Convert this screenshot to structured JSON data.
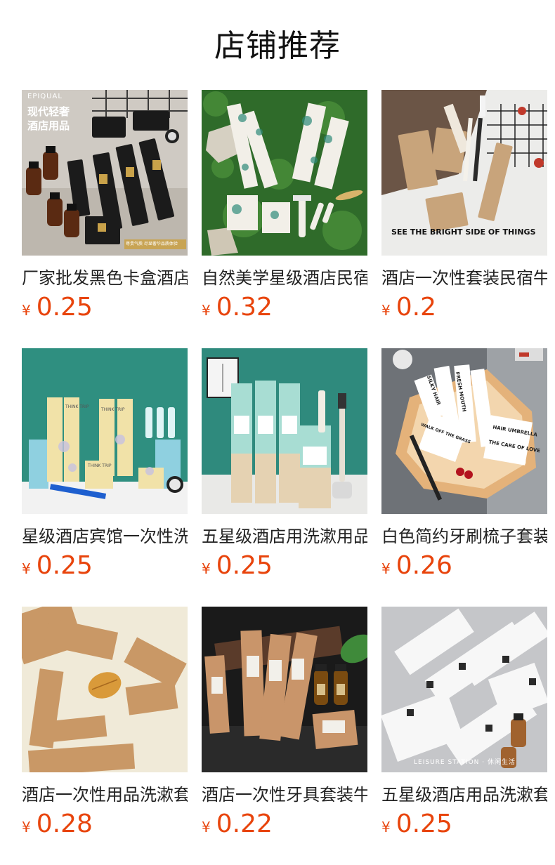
{
  "header": {
    "title": "店铺推荐"
  },
  "currency": "¥",
  "products": [
    {
      "name": "厂家批发黑色卡盒酒店用品套装",
      "price": "0.25",
      "image_text": [
        "EPIQUAL",
        "现代轻奢",
        "酒店用品",
        "尊贵气质 尽显奢华品质体验"
      ]
    },
    {
      "name": "自然美学星级酒店民宿一次性用品",
      "price": "0.32",
      "image_text": []
    },
    {
      "name": "酒店一次性套装民宿牛皮纸洗漱用品",
      "price": "0.2",
      "image_text": [
        "SEE THE BRIGHT SIDE OF THINGS"
      ]
    },
    {
      "name": "星级酒店宾馆一次性洗漱用品套装",
      "price": "0.25",
      "image_text": [
        "THINK TRIP",
        "THINK TRIP",
        "THINK TRIP"
      ]
    },
    {
      "name": "五星级酒店用洗漱用品牙具套装",
      "price": "0.25",
      "image_text": []
    },
    {
      "name": "白色简约牙刷梳子套装酒店用品",
      "price": "0.26",
      "image_text": [
        "HAIR UMBRELLA",
        "THE CARE OF LOVE",
        "FRESH MOUTH",
        "SILKY HAIR",
        "WALK OFF THE GRASS"
      ]
    },
    {
      "name": "酒店一次性用品洗漱套装牛皮纸",
      "price": "0.28",
      "image_text": []
    },
    {
      "name": "酒店一次性牙具套装牛皮纸盒",
      "price": "0.22",
      "image_text": []
    },
    {
      "name": "五星级酒店用品洗漱套装白色",
      "price": "0.25",
      "image_text": [
        "LEISURE STATION · 休闲生活"
      ]
    }
  ],
  "colors": {
    "price": "#e8440c",
    "title": "#111111",
    "name": "#222222"
  },
  "icons": [
    "product-thumbnail"
  ]
}
